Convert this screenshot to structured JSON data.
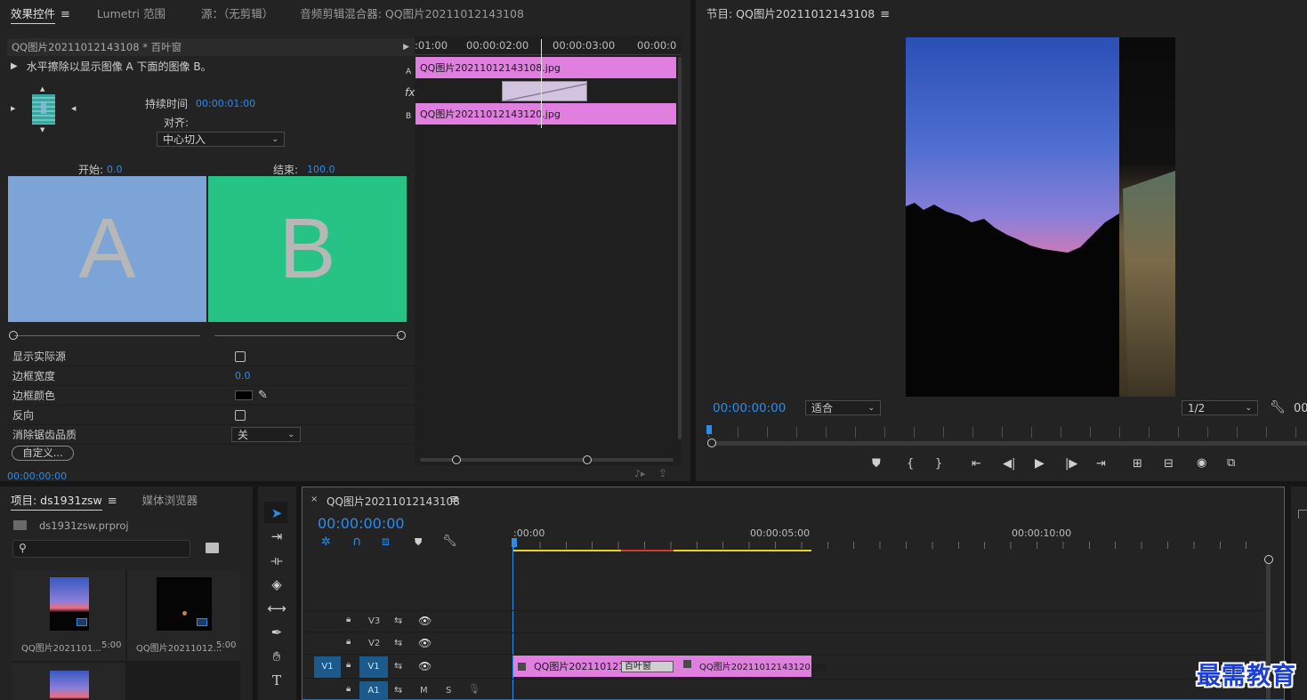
{
  "effect_controls": {
    "tabs": [
      "效果控件",
      "Lumetri 范围",
      "源：（无剪辑）",
      "音频剪辑混合器: QQ图片20211012143108"
    ],
    "clip_header": "QQ图片20211012143108 * 百叶窗",
    "description": "水平擦除以显示图像 A 下面的图像 B。",
    "duration_label": "持续时间",
    "duration_value": "00:00:01:00",
    "align_label": "对齐:",
    "align_value": "中心切入",
    "start_label": "开始:",
    "start_value": "0.0",
    "end_label": "结束:",
    "end_value": "100.0",
    "preview_a": "A",
    "preview_b": "B",
    "show_actual_sources": "显示实际源",
    "border_width_label": "边框宽度",
    "border_width_value": "0.0",
    "border_color_label": "边框颜色",
    "reverse_label": "反向",
    "antialias_label": "消除锯齿品质",
    "antialias_value": "关",
    "custom_button": "自定义...",
    "timecode": "00:00:00:00",
    "mini_timeline": {
      "ruler": [
        ":01:00",
        "00:00:02:00",
        "00:00:03:00",
        "00:00:0"
      ],
      "track_a_label": "A",
      "track_b_label": "B",
      "clip_a": "QQ图片20211012143108.jpg",
      "clip_b": "QQ图片20211012143120.jpg",
      "fx_label": "fx"
    }
  },
  "program_monitor": {
    "title": "节目: QQ图片20211012143108",
    "timecode": "00:00:00:00",
    "fit_value": "适合",
    "resolution_value": "1/2",
    "right_edge_text": "00"
  },
  "project": {
    "tabs": [
      "项目: ds1931zsw",
      "媒体浏览器"
    ],
    "file_name": "ds1931zsw.prproj",
    "items": [
      {
        "name": "QQ图片2021101...",
        "duration": "5:00"
      },
      {
        "name": "QQ图片20211012...",
        "duration": "5:00"
      }
    ]
  },
  "timeline": {
    "tab_title": "QQ图片20211012143108",
    "timecode": "00:00:00:00",
    "ruler": [
      ":00:00",
      "00:00:05:00",
      "00:00:10:00"
    ],
    "tracks": [
      {
        "id": "V3",
        "source": ""
      },
      {
        "id": "V2",
        "source": ""
      },
      {
        "id": "V1",
        "source": "V1"
      },
      {
        "id": "A1",
        "source": "",
        "m": "M",
        "s": "S"
      }
    ],
    "clip1": "QQ图片2021101214",
    "transition": "百叶窗",
    "clip2": "QQ图片20211012143120.jpg"
  },
  "watermark": "最需教育",
  "colors": {
    "accent_blue": "#2d8ceb",
    "clip_pink": "#e07fe0",
    "preview_a": "#7ca4d6",
    "preview_b": "#27c384",
    "work_yellow": "#e6d521",
    "render_red": "#d33a2a"
  }
}
